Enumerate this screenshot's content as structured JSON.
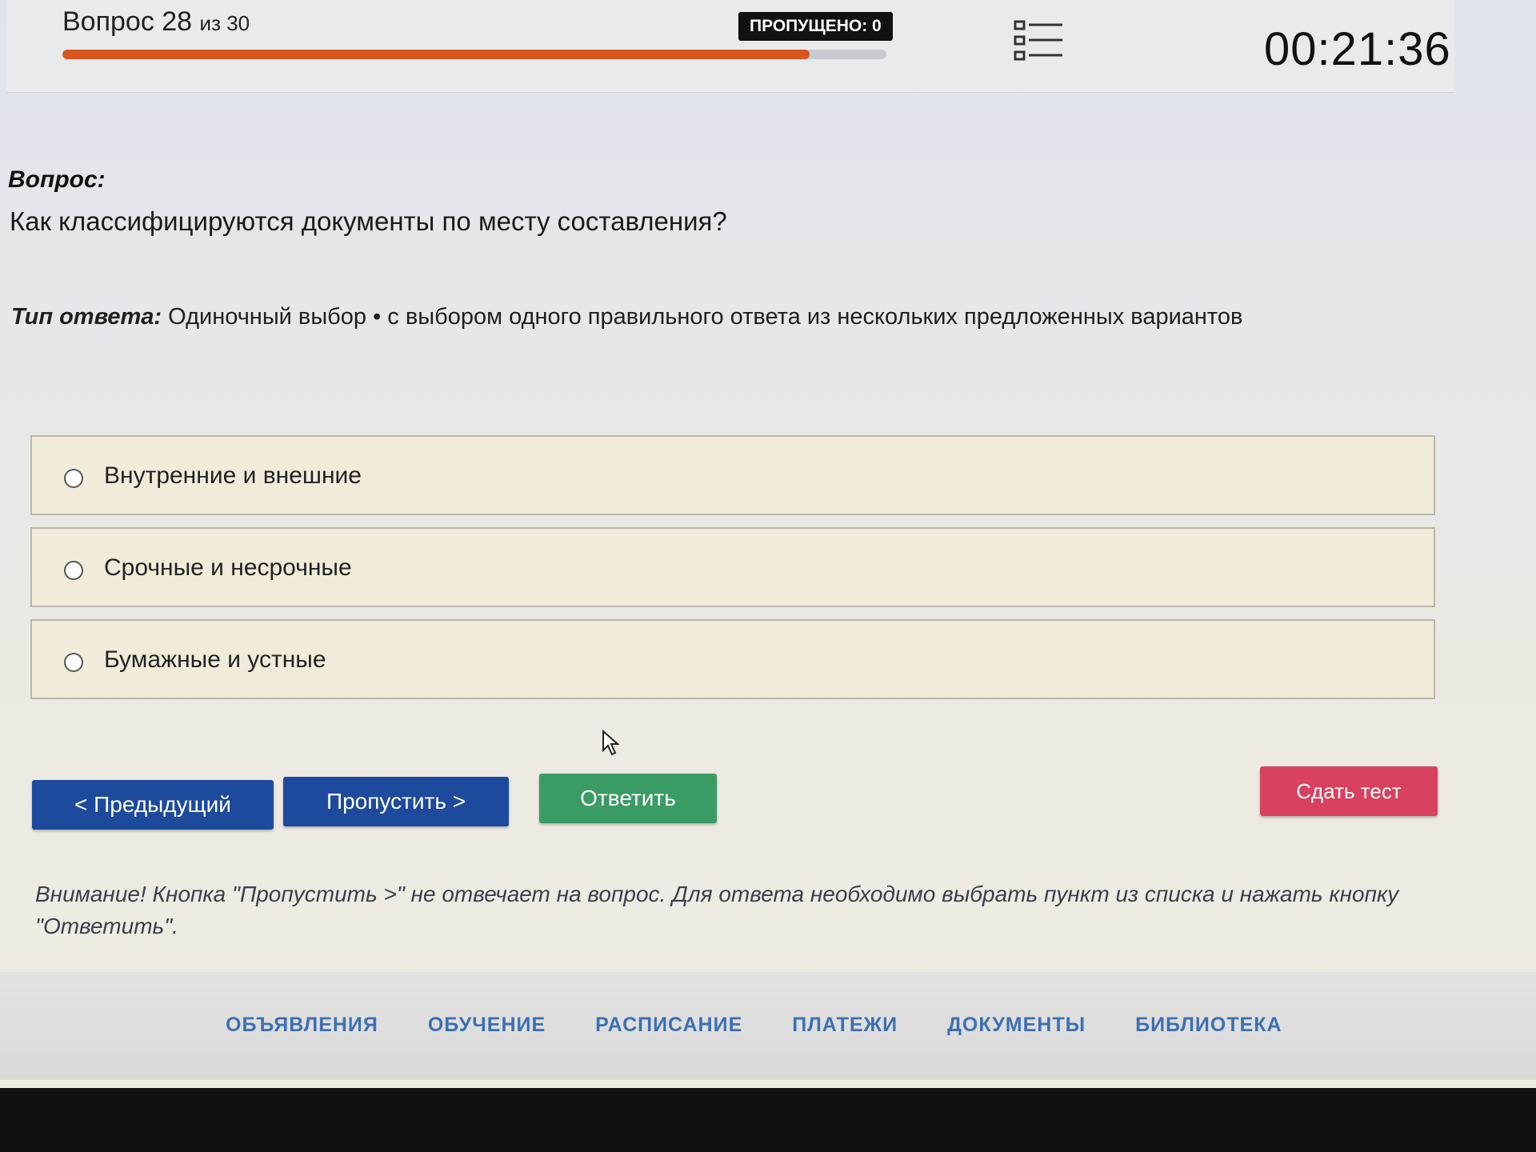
{
  "header": {
    "question_word": "Вопрос 28",
    "question_of": "из 30",
    "progress_fraction": 0.907,
    "skipped_label": "ПРОПУЩЕНО: 0",
    "timer": "00:21:36"
  },
  "question": {
    "label": "Вопрос:",
    "text": "Как классифицируются документы по месту составления?"
  },
  "answer_type": {
    "label": "Тип ответа:",
    "value": "Одиночный выбор • с выбором одного правильного ответа из нескольких предложенных вариантов"
  },
  "options": [
    {
      "label": "Внутренние и внешние"
    },
    {
      "label": "Срочные и несрочные"
    },
    {
      "label": "Бумажные и устные"
    }
  ],
  "buttons": {
    "prev": "< Предыдущий",
    "skip": "Пропустить >",
    "answer": "Ответить",
    "submit": "Сдать тест"
  },
  "warning": "Внимание! Кнопка \"Пропустить >\" не отвечает на вопрос. Для ответа необходимо выбрать пункт из списка и нажать кнопку \"Ответить\".",
  "footer_nav": [
    "ОБЪЯВЛЕНИЯ",
    "ОБУЧЕНИЕ",
    "РАСПИСАНИЕ",
    "ПЛАТЕЖИ",
    "ДОКУМЕНТЫ",
    "БИБЛИОТЕКА"
  ],
  "colors": {
    "progress": "#d9561f",
    "primary_button": "#1d4a9c",
    "answer_button": "#3a9b64",
    "submit_button": "#d8415f",
    "footer_link": "#3d6fb1"
  },
  "icons": [
    "question-list-icon",
    "radio-icon",
    "mouse-cursor-icon"
  ]
}
